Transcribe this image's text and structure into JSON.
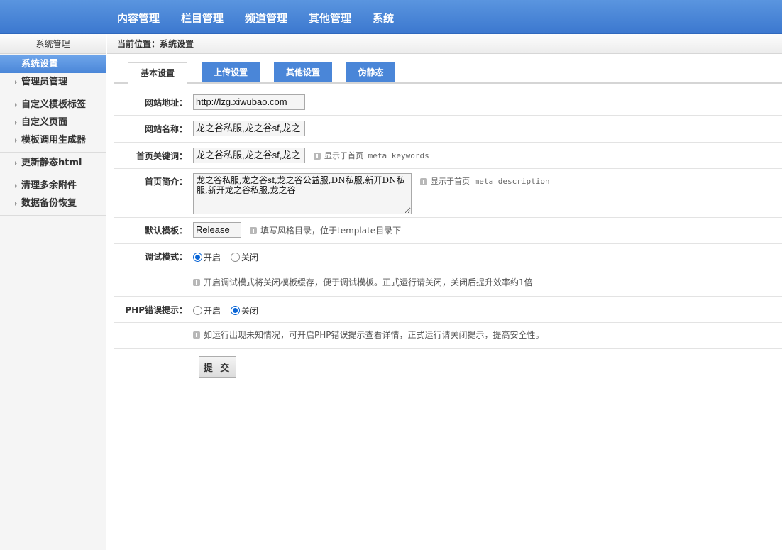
{
  "topnav": [
    "内容管理",
    "栏目管理",
    "频道管理",
    "其他管理",
    "系统"
  ],
  "sidebar": {
    "title": "系统管理",
    "groups": [
      [
        "系统设置",
        "管理员管理"
      ],
      [
        "自定义模板标签",
        "自定义页面",
        "模板调用生成器"
      ],
      [
        "更新静态html"
      ],
      [
        "清理多余附件",
        "数据备份恢复"
      ]
    ],
    "active": "系统设置"
  },
  "breadcrumb": "当前位置：系统设置",
  "tabs": [
    "基本设置",
    "上传设置",
    "其他设置",
    "伪静态"
  ],
  "form": {
    "site_url": {
      "label": "网站地址：",
      "value": "http://lzg.xiwubao.com"
    },
    "site_name": {
      "label": "网站名称：",
      "value": "龙之谷私服,龙之谷sf,龙之"
    },
    "keywords": {
      "label": "首页关键词：",
      "value": "龙之谷私服,龙之谷sf,龙之",
      "tip": "显示于首页 meta keywords"
    },
    "description": {
      "label": "首页简介：",
      "value": "龙之谷私服,龙之谷sf,龙之谷公益服,DN私服,新开DN私服,新开龙之谷私服,龙之谷",
      "tip": "显示于首页 meta description"
    },
    "template": {
      "label": "默认模板：",
      "value": "Release",
      "tip": "填写风格目录，位于template目录下"
    },
    "debug": {
      "label": "调试模式：",
      "on": "开启",
      "off": "关闭",
      "selected": "on",
      "tip": "开启调试模式将关闭模板缓存，便于调试模板。正式运行请关闭，关闭后提升效率约1倍"
    },
    "php_error": {
      "label": "PHP错误提示：",
      "on": "开启",
      "off": "关闭",
      "selected": "off",
      "tip": "如运行出现未知情况，可开启PHP错误提示查看详情，正式运行请关闭提示，提高安全性。"
    },
    "submit": "提 交"
  },
  "colors": {
    "accent": "#4a86d8",
    "radio": "#0b66d6"
  }
}
